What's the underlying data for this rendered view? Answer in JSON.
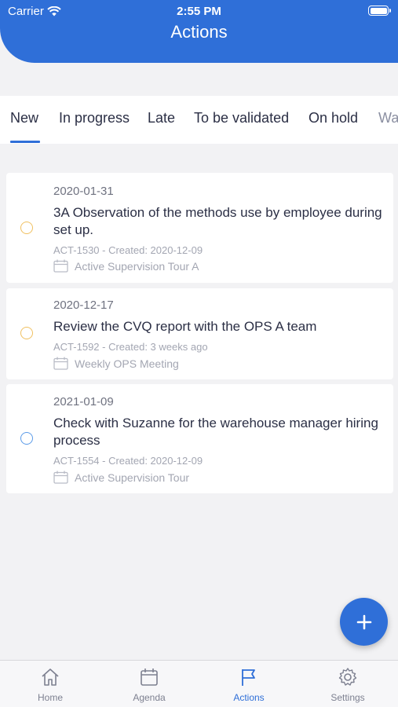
{
  "status_bar": {
    "carrier": "Carrier",
    "time": "2:55 PM"
  },
  "header": {
    "title": "Actions"
  },
  "tabs": [
    {
      "label": "New",
      "active": true
    },
    {
      "label": "In progress"
    },
    {
      "label": "Late"
    },
    {
      "label": "To be validated"
    },
    {
      "label": "On hold"
    },
    {
      "label": "Wa"
    }
  ],
  "actions": [
    {
      "date": "2020-01-31",
      "title": "3A Observation of the methods use by employee during set up.",
      "meta": "ACT-1530 - Created: 2020-12-09",
      "event": "Active Supervision Tour A",
      "status_color": "#f0c060"
    },
    {
      "date": "2020-12-17",
      "title": "Review the CVQ report with the OPS A team",
      "meta": "ACT-1592 - Created: 3 weeks ago",
      "event": "Weekly OPS Meeting",
      "status_color": "#f0c060"
    },
    {
      "date": "2021-01-09",
      "title": "Check with Suzanne for the warehouse manager hiring process",
      "meta": "ACT-1554 - Created: 2020-12-09",
      "event": "Active Supervision Tour",
      "status_color": "#5b9be8"
    }
  ],
  "bottom_nav": [
    {
      "label": "Home",
      "icon": "home-icon"
    },
    {
      "label": "Agenda",
      "icon": "calendar-icon"
    },
    {
      "label": "Actions",
      "icon": "flag-icon",
      "active": true
    },
    {
      "label": "Settings",
      "icon": "gear-icon"
    }
  ],
  "colors": {
    "accent": "#2f6fd8",
    "pending": "#f0c060",
    "new": "#5b9be8"
  }
}
